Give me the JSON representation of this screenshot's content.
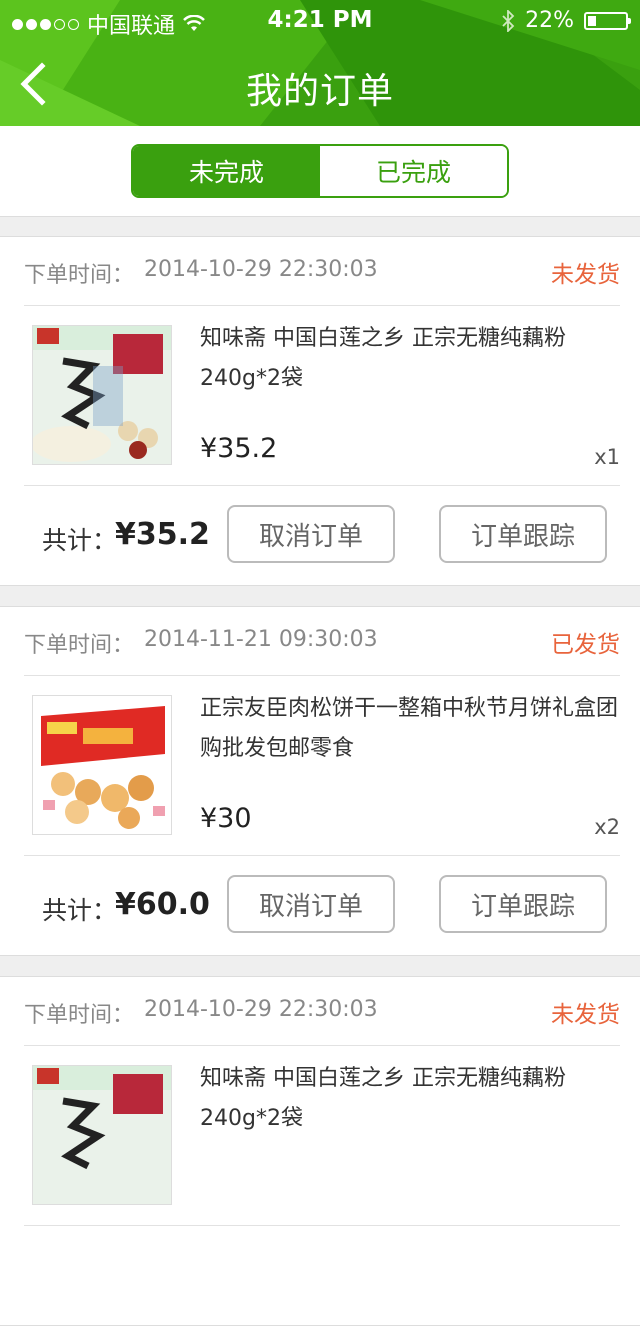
{
  "status_bar": {
    "carrier": "中国联通",
    "time": "4:21 PM",
    "battery": "22%",
    "battery_level": 0.22
  },
  "header": {
    "title": "我的订单",
    "back_icon": "chevron-left-icon"
  },
  "tabs": [
    {
      "label": "未完成",
      "active": true
    },
    {
      "label": "已完成",
      "active": false
    }
  ],
  "orders": [
    {
      "time_label": "下单时间：",
      "time": "2014-10-29  22:30:03",
      "status": "未发货",
      "name": "知味斋  中国白莲之乡  正宗无糖纯藕粉240g*2袋",
      "price": "¥35.2",
      "qty": "x1",
      "total_label": "共计：",
      "total": "¥35.2",
      "cancel_label": "取消订单",
      "track_label": "订单跟踪"
    },
    {
      "time_label": "下单时间：",
      "time": "2014-11-21  09:30:03",
      "status": "已发货",
      "name": "正宗友臣肉松饼干一整箱中秋节月饼礼盒团购批发包邮零食",
      "price": "¥30",
      "qty": "x2",
      "total_label": "共计：",
      "total": "¥60.0",
      "cancel_label": "取消订单",
      "track_label": "订单跟踪"
    },
    {
      "time_label": "下单时间：",
      "time": "2014-10-29  22:30:03",
      "status": "未发货",
      "name": "知味斋  中国白莲之乡  正宗无糖纯藕粉240g*2袋",
      "price": "",
      "qty": "",
      "total_label": "",
      "total": "",
      "cancel_label": "",
      "track_label": ""
    }
  ]
}
